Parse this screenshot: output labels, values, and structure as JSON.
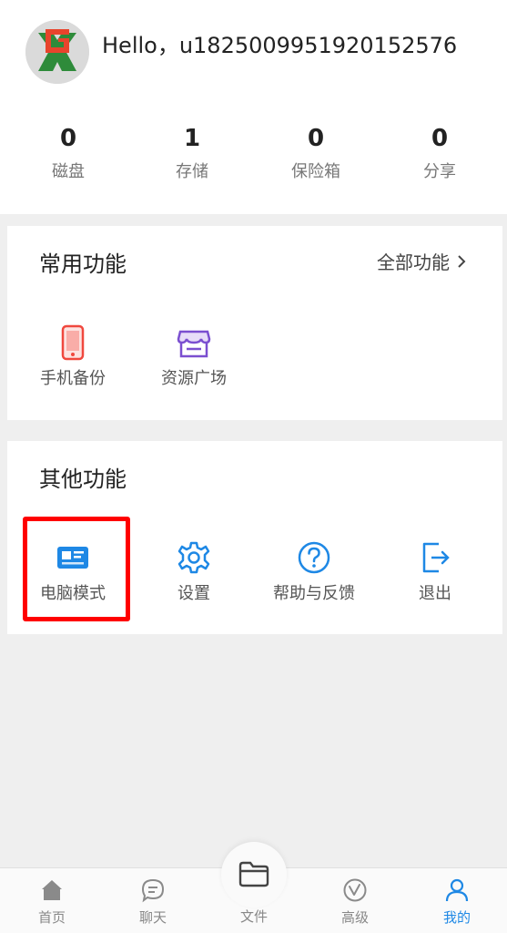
{
  "header": {
    "greeting": "Hello，u1825009951920152576",
    "stats": [
      {
        "value": "0",
        "label": "磁盘"
      },
      {
        "value": "1",
        "label": "存储"
      },
      {
        "value": "0",
        "label": "保险箱"
      },
      {
        "value": "0",
        "label": "分享"
      }
    ]
  },
  "common": {
    "title": "常用功能",
    "all_link": "全部功能",
    "items": [
      {
        "label": "手机备份",
        "icon": "phone-icon"
      },
      {
        "label": "资源广场",
        "icon": "store-icon"
      }
    ]
  },
  "other": {
    "title": "其他功能",
    "items": [
      {
        "label": "电脑模式",
        "icon": "desktop-card-icon"
      },
      {
        "label": "设置",
        "icon": "gear-icon"
      },
      {
        "label": "帮助与反馈",
        "icon": "help-icon"
      },
      {
        "label": "退出",
        "icon": "logout-icon"
      }
    ]
  },
  "tabbar": {
    "tabs": [
      {
        "label": "首页",
        "icon": "home-icon"
      },
      {
        "label": "聊天",
        "icon": "chat-icon"
      },
      {
        "label": "文件",
        "icon": "folder-icon"
      },
      {
        "label": "高级",
        "icon": "vip-icon"
      },
      {
        "label": "我的",
        "icon": "user-icon",
        "active": true
      }
    ]
  },
  "colors": {
    "accent": "#1e88e5",
    "highlight": "#ff0000",
    "phone_icon": "#f0483e",
    "store_icon": "#7b4fd0"
  }
}
